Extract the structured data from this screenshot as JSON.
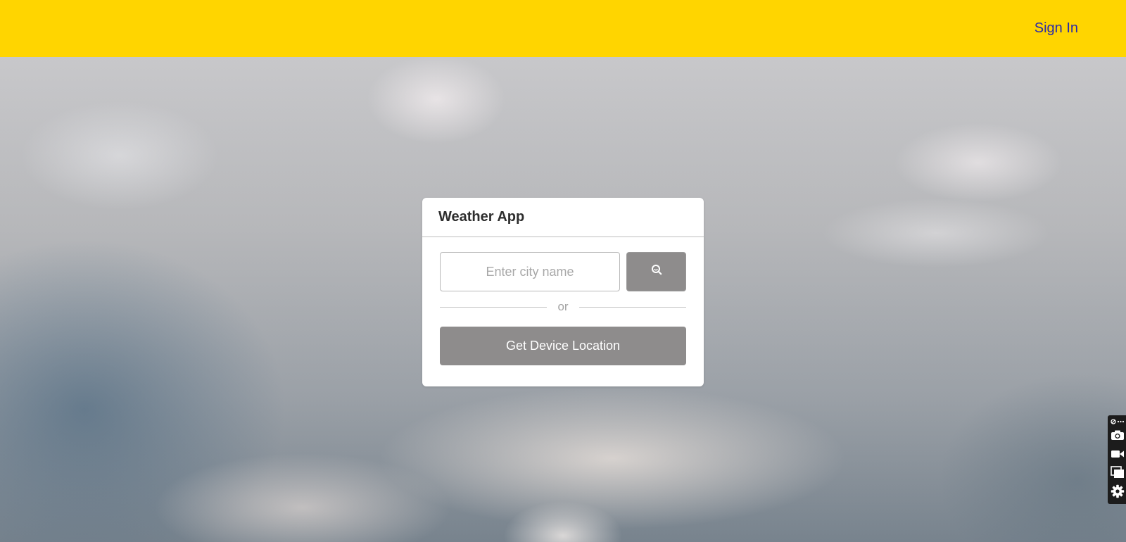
{
  "header": {
    "sign_in_label": "Sign In"
  },
  "card": {
    "title": "Weather App",
    "city_input": {
      "value": "",
      "placeholder": "Enter city name"
    },
    "search_icon": "search-icon",
    "divider_text": "or",
    "device_location_label": "Get Device Location"
  },
  "side_toolbar": {
    "items": [
      "link-more-icon",
      "camera-icon",
      "video-icon",
      "window-icon",
      "gear-icon"
    ]
  },
  "colors": {
    "topbar": "#ffd500",
    "sign_in": "#2a2aa8",
    "button": "#8e8c8c",
    "card": "#ffffff"
  }
}
